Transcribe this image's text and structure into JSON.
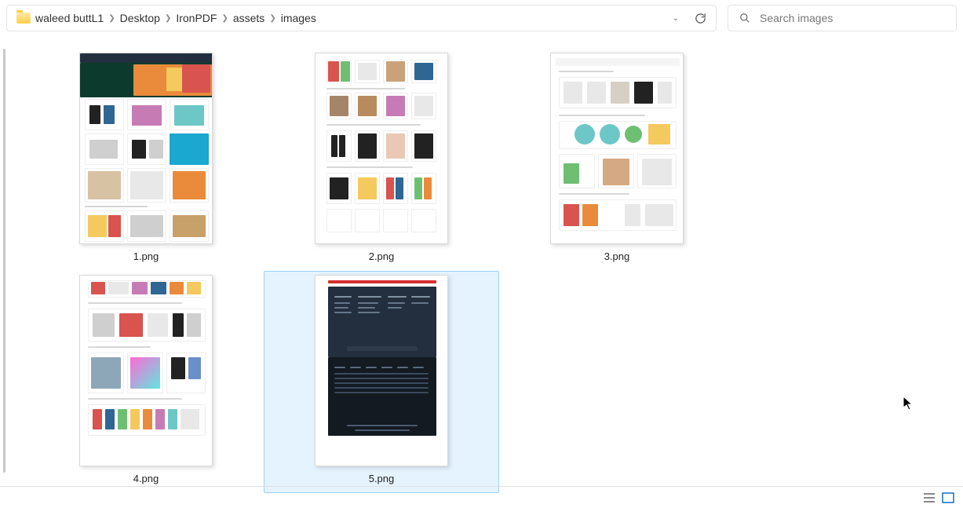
{
  "breadcrumbs": [
    "waleed buttL1",
    "Desktop",
    "IronPDF",
    "assets",
    "images"
  ],
  "search": {
    "placeholder": "Search images"
  },
  "files": [
    {
      "name": "1.png"
    },
    {
      "name": "2.png"
    },
    {
      "name": "3.png"
    },
    {
      "name": "4.png"
    },
    {
      "name": "5.png"
    }
  ],
  "selected_index": 4
}
